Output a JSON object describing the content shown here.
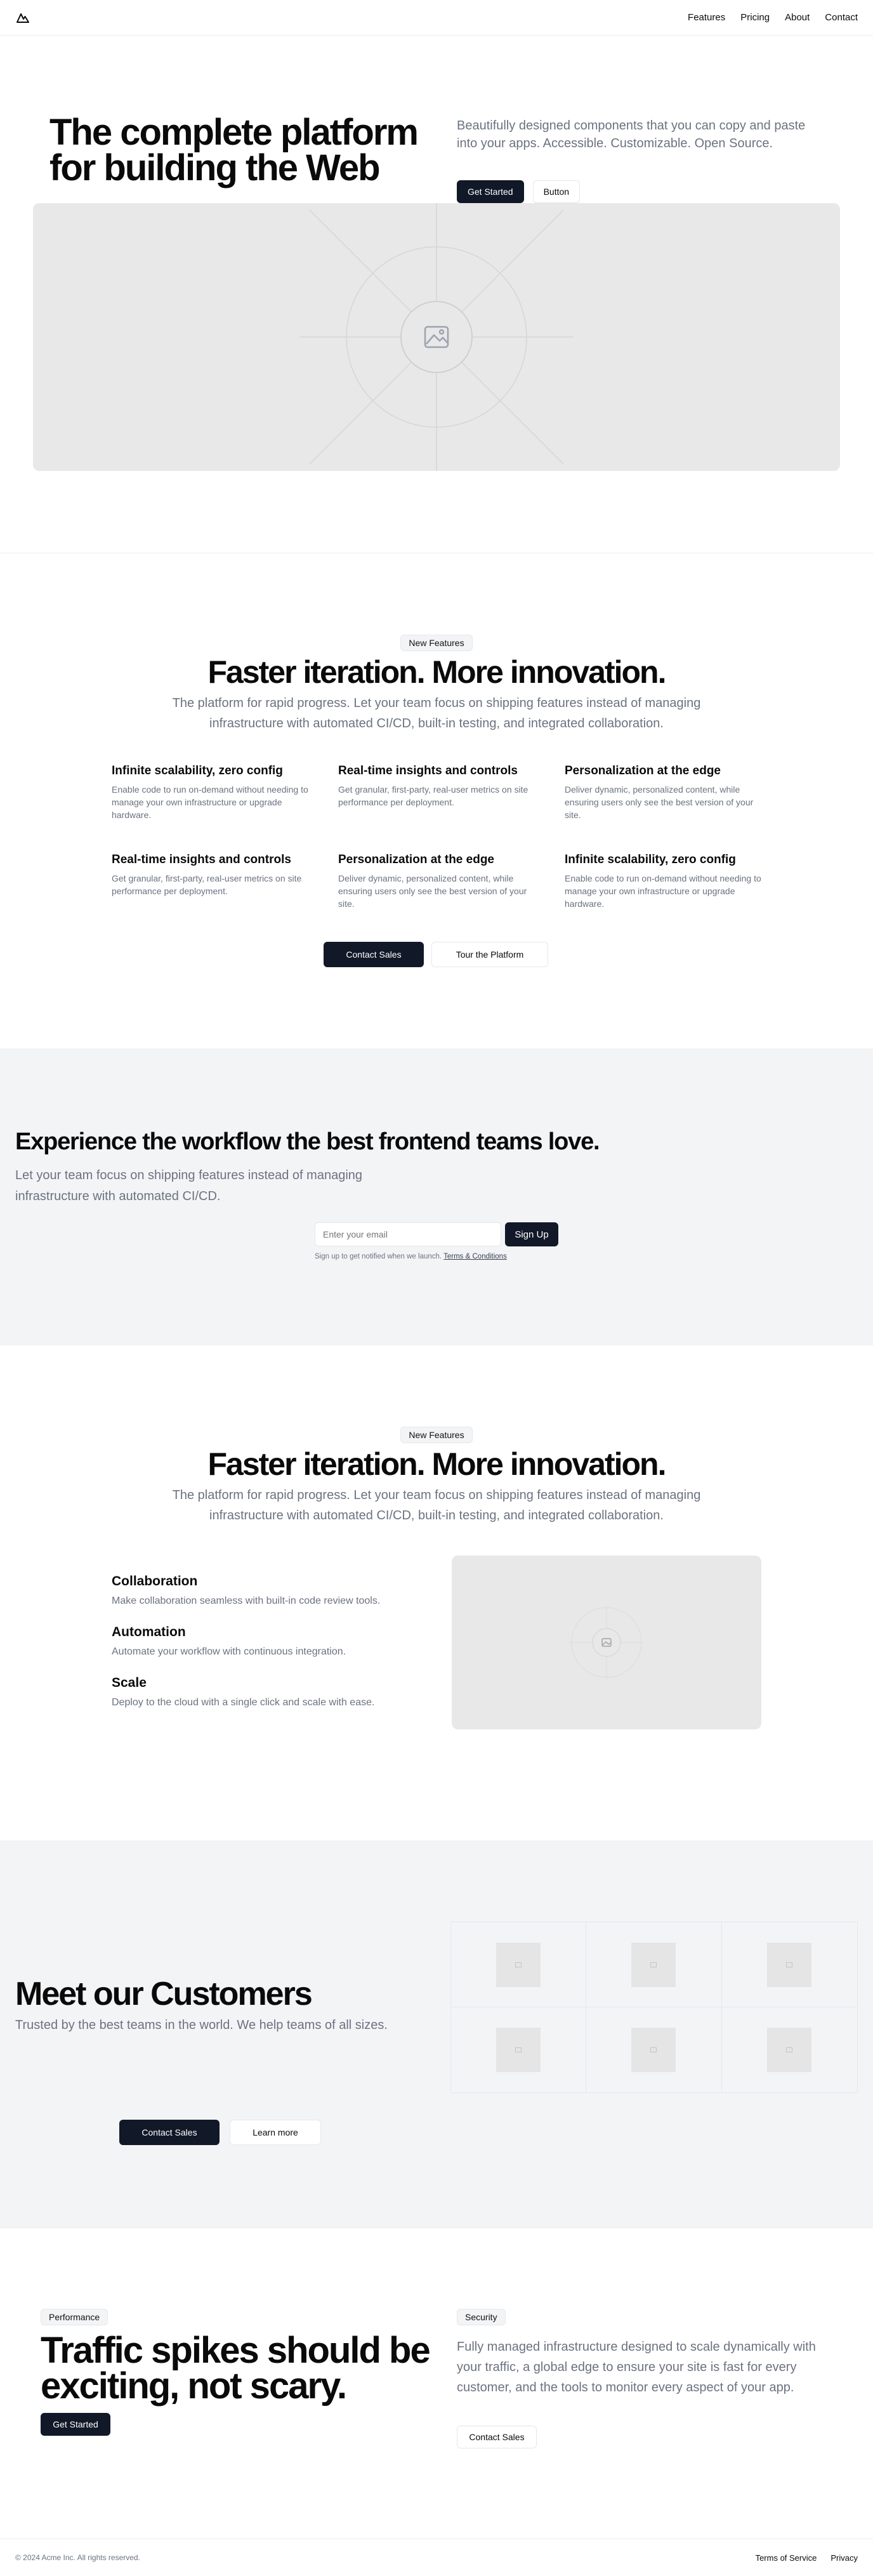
{
  "nav": {
    "logo_icon": "mountain-logo-icon",
    "items": [
      "Features",
      "Pricing",
      "About",
      "Contact"
    ]
  },
  "hero": {
    "title": "The complete platform for building the Web",
    "description": "Beautifully designed components that you can copy and paste into your apps. Accessible. Customizable. Open Source.",
    "primary_label": "Get Started",
    "secondary_label": "Button",
    "image_icon": "image-placeholder-icon"
  },
  "features1": {
    "badge": "New Features",
    "title": "Faster iteration. More innovation.",
    "description": "The platform for rapid progress. Let your team focus on shipping features instead of managing infrastructure with automated CI/CD, built-in testing, and integrated collaboration.",
    "items": [
      {
        "title": "Infinite scalability, zero config",
        "text": "Enable code to run on-demand without needing to manage your own infrastructure or upgrade hardware."
      },
      {
        "title": "Real-time insights and controls",
        "text": "Get granular, first-party, real-user metrics on site performance per deployment."
      },
      {
        "title": "Personalization at the edge",
        "text": "Deliver dynamic, personalized content, while ensuring users only see the best version of your site."
      },
      {
        "title": "Real-time insights and controls",
        "text": "Get granular, first-party, real-user metrics on site performance per deployment."
      },
      {
        "title": "Personalization at the edge",
        "text": "Deliver dynamic, personalized content, while ensuring users only see the best version of your site."
      },
      {
        "title": "Infinite scalability, zero config",
        "text": "Enable code to run on-demand without needing to manage your own infrastructure or upgrade hardware."
      }
    ],
    "primary_label": "Contact Sales",
    "secondary_label": "Tour the Platform"
  },
  "workflow": {
    "title": "Experience the workflow the best frontend teams love.",
    "description": "Let your team focus on shipping features instead of managing infrastructure with automated CI/CD.",
    "email_placeholder": "Enter your email",
    "signup_label": "Sign Up",
    "note": "Sign up to get notified when we launch.",
    "terms_link": "Terms & Conditions"
  },
  "features2": {
    "badge": "New Features",
    "title": "Faster iteration. More innovation.",
    "description": "The platform for rapid progress. Let your team focus on shipping features instead of managing infrastructure with automated CI/CD, built-in testing, and integrated collaboration.",
    "items": [
      {
        "title": "Collaboration",
        "text": "Make collaboration seamless with built-in code review tools."
      },
      {
        "title": "Automation",
        "text": "Automate your workflow with continuous integration."
      },
      {
        "title": "Scale",
        "text": "Deploy to the cloud with a single click and scale with ease."
      }
    ]
  },
  "customers": {
    "title": "Meet our Customers",
    "description": "Trusted by the best teams in the world. We help teams of all sizes.",
    "primary_label": "Contact Sales",
    "secondary_label": "Learn more"
  },
  "performance": {
    "badge": "Performance",
    "title": "Traffic spikes should be exciting, not scary.",
    "button_label": "Get Started"
  },
  "security": {
    "badge": "Security",
    "description": "Fully managed infrastructure designed to scale dynamically with your traffic, a global edge to ensure your site is fast for every customer, and the tools to monitor every aspect of your app.",
    "button_label": "Contact Sales"
  },
  "footer": {
    "copyright": "© 2024 Acme Inc. All rights reserved.",
    "links": [
      "Terms of Service",
      "Privacy"
    ]
  },
  "colors": {
    "primary": "#111827",
    "muted_text": "#6b7280",
    "section_bg": "#f3f4f6",
    "placeholder_bg": "#e8e8e8"
  }
}
